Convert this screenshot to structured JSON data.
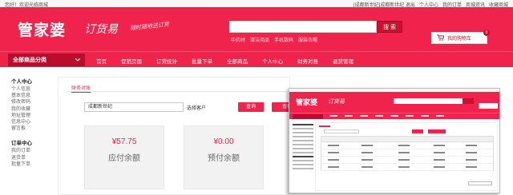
{
  "topbar": {
    "welcome": "您好！欢迎光临商城",
    "links": [
      "[成都新世纪]成都新世纪 退出",
      "个人中心",
      "我的订单",
      "商城资讯",
      "收藏商城"
    ]
  },
  "header": {
    "logo": "管家婆",
    "logo_sub": "订货易",
    "slogan": "随时随地送订货",
    "search_button": "搜 索",
    "hot_words": [
      "中药材",
      "清洁用品",
      "手机数码",
      "服装衣帽"
    ],
    "cart_label": "我的购物车",
    "cart_count": "0"
  },
  "nav": {
    "category_label": "全部商品分类",
    "links": [
      "首页",
      "促销页面",
      "订货统计",
      "批量下单",
      "全部商品",
      "个人中心",
      "财务对账",
      "退货管理"
    ]
  },
  "sidebar": {
    "groups": [
      {
        "title": "个人中心",
        "items": [
          "个人信息",
          "基本信息",
          "修改密码",
          "我的收藏",
          "地址管理",
          "信息中心",
          "留言板"
        ]
      },
      {
        "title": "订单中心",
        "items": [
          "我的订单",
          "退货单",
          "批量下单"
        ]
      }
    ]
  },
  "main": {
    "tab": "财务对账",
    "account_value": "成都新世纪",
    "choose_customer": "选择客户",
    "query_button": "查询",
    "detail_button": "查看往来明细",
    "cards": [
      {
        "amount": "¥57.75",
        "label": "应付余额"
      },
      {
        "amount": "¥0.00",
        "label": "预付余额"
      }
    ]
  },
  "colors": {
    "brand": "#ef234b",
    "brand_dark": "#b80d2c"
  }
}
